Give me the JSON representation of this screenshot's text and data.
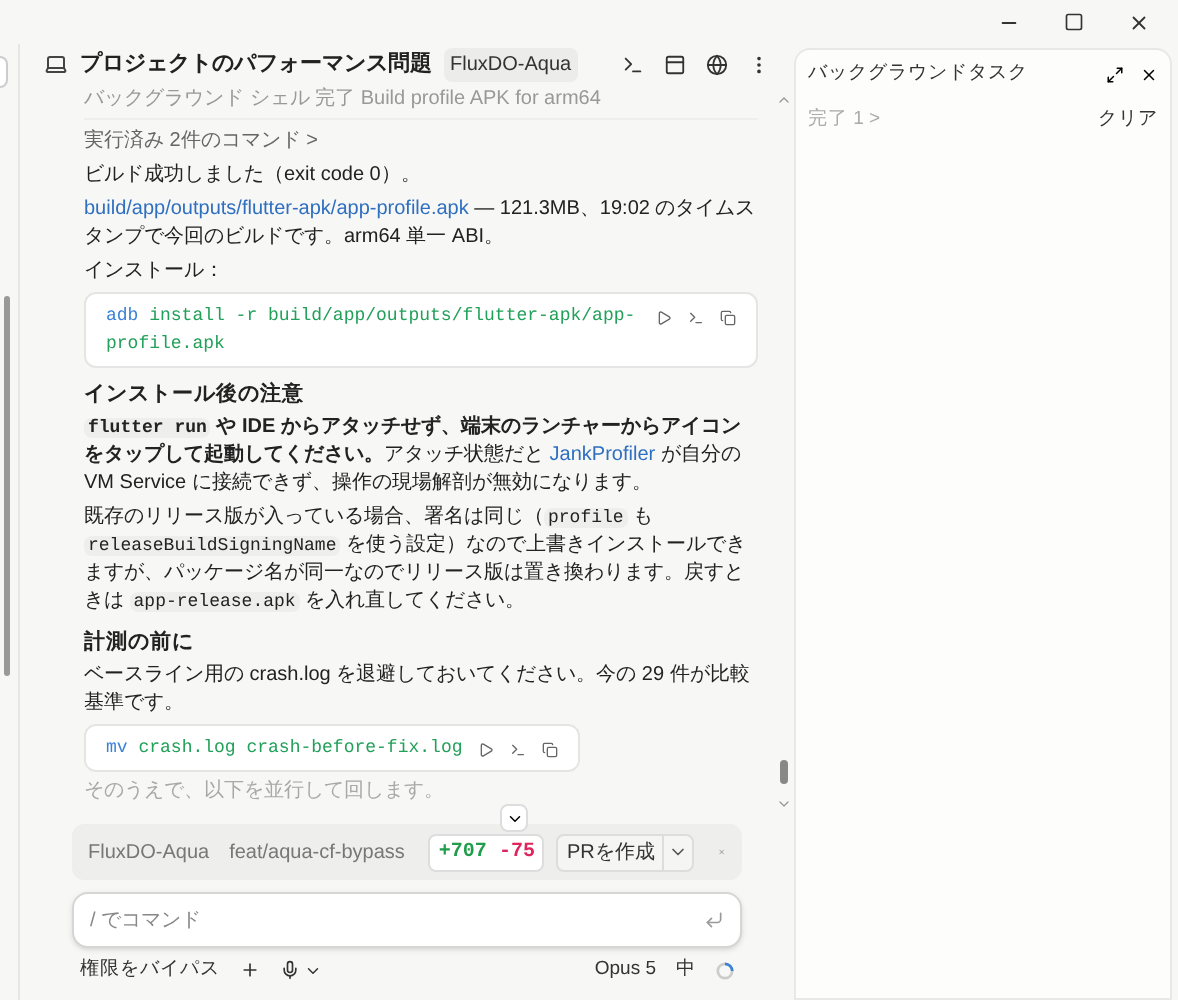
{
  "window": {
    "title": "プロジェクトのパフォーマンス問題",
    "badge": "FluxDO-Aqua"
  },
  "thread": {
    "status_line": "バックグラウンド シェル 完了 Build profile APK for arm64",
    "commands_toggle": "実行済み 2件のコマンド >",
    "blocks": [
      {
        "kind": "paragraph",
        "segments": [
          {
            "kind": "text",
            "text": "ビルド成功しました（exit code 0）。"
          }
        ]
      },
      {
        "kind": "paragraph",
        "segments": [
          {
            "kind": "link",
            "text": "build/app/outputs/flutter-apk/app-profile.apk"
          },
          {
            "kind": "text",
            "text": " — 121.3MB、19:02 のタイムスタンプで今回のビルドです。arm64 単一 ABI。"
          }
        ]
      },
      {
        "kind": "paragraph",
        "segments": [
          {
            "kind": "text",
            "text": "インストール："
          }
        ]
      },
      {
        "kind": "code",
        "command": "adb",
        "args": " install -r build/app/outputs/flutter-apk/app-profile.apk"
      },
      {
        "kind": "heading",
        "text": "インストール後の注意"
      },
      {
        "kind": "paragraph",
        "segments": [
          {
            "kind": "code",
            "text": "flutter run",
            "bold": true
          },
          {
            "kind": "text",
            "text": " や IDE からアタッチせず、端末のランチャーからアイコンをタップして起動してください。",
            "bold": true
          },
          {
            "kind": "text",
            "text": "アタッチ状態だと "
          },
          {
            "kind": "link",
            "text": "JankProfiler"
          },
          {
            "kind": "text",
            "text": " が自分の VM Service に接続できず、操作の現場解剖が無効になります。"
          }
        ]
      },
      {
        "kind": "paragraph",
        "segments": [
          {
            "kind": "text",
            "text": "既存のリリース版が入っている場合、署名は同じ（"
          },
          {
            "kind": "code",
            "text": "profile"
          },
          {
            "kind": "text",
            "text": " も "
          },
          {
            "kind": "code",
            "text": "releaseBuildSigningName"
          },
          {
            "kind": "text",
            "text": " を使う設定）なので上書きインストールできますが、パッケージ名が同一なのでリリース版は置き換わります。戻すときは "
          },
          {
            "kind": "code",
            "text": "app-release.apk"
          },
          {
            "kind": "text",
            "text": " を入れ直してください。"
          }
        ]
      },
      {
        "kind": "heading",
        "text": "計測の前に"
      },
      {
        "kind": "paragraph",
        "segments": [
          {
            "kind": "text",
            "text": "ベースライン用の crash.log を退避しておいてください。今の 29 件が比較基準です。"
          }
        ]
      },
      {
        "kind": "code",
        "command": "mv",
        "args": " crash.log crash-before-fix.log"
      }
    ],
    "faded_line": "そのうえで、以下を並行して回します。"
  },
  "branch_bar": {
    "repo": "FluxDO-Aqua",
    "branch": "feat/aqua-cf-bypass",
    "added": "+707",
    "removed": "-75",
    "pr_button": "PRを作成"
  },
  "composer": {
    "placeholder": "/ でコマンド"
  },
  "footer": {
    "permission": "権限をバイパス",
    "model": "Opus 5",
    "effort": "中"
  },
  "background_tasks": {
    "title": "バックグラウンドタスク",
    "completed": "完了 1 >",
    "clear": "クリア"
  }
}
